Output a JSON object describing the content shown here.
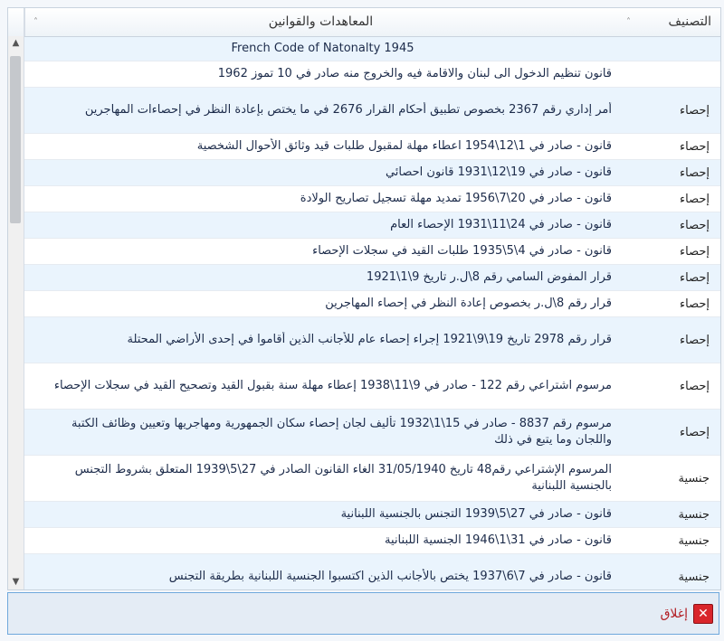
{
  "grid": {
    "columns": {
      "law": "المعاهدات والقوانين",
      "classification": "التصنيف",
      "sort_glyph": "˄"
    },
    "rows": [
      {
        "class": "",
        "text": "French Code of Natonalty 1945",
        "h": 27
      },
      {
        "class": "",
        "text": "قانون تنظيم الدخول الى لبنان والاقامة فيه والخروج منه صادر في 10 تموز 1962",
        "h": 29
      },
      {
        "class": "إحصاء",
        "text": "أمر إداري رقم 2367 بخصوص تطبيق أحكام القرار 2676 في ما يختص بإعادة النظر في إحصاءات المهاجرين",
        "h": 51
      },
      {
        "class": "إحصاء",
        "text": "قانون - صادر في 1\\12\\1954 اعطاء مهلة لمقبول طلبات قيد وثائق الأحوال الشخصية",
        "h": 29
      },
      {
        "class": "إحصاء",
        "text": "قانون - صادر في 19\\12\\1931 قانون احصائي",
        "h": 29
      },
      {
        "class": "إحصاء",
        "text": "قانون - صادر في 20\\7\\1956 تمديد مهلة تسجيل تصاريح الولادة",
        "h": 29
      },
      {
        "class": "إحصاء",
        "text": "قانون - صادر في 24\\11\\1931 الإحصاء العام",
        "h": 29
      },
      {
        "class": "إحصاء",
        "text": "قانون - صادر في 4\\5\\1935 طلبات القيد في سجلات الإحصاء",
        "h": 29
      },
      {
        "class": "إحصاء",
        "text": "قرار المفوض السامي رقم 8\\ل.ر تاريخ 9\\1\\1921",
        "h": 29
      },
      {
        "class": "إحصاء",
        "text": "قرار رقم 8\\ل.ر بخصوص إعادة النظر في إحصاء المهاجرين",
        "h": 29
      },
      {
        "class": "إحصاء",
        "text": "قرار رقم 2978 تاريخ 19\\9\\1921 إجراء إحصاء عام للأجانب الذين أقاموا في إحدى الأراضي المحتلة",
        "h": 51
      },
      {
        "class": "إحصاء",
        "text": "مرسوم اشتراعي رقم 122 - صادر في 9\\11\\1938 إعطاء مهلة سنة بقبول القيد وتصحيح القيد في سجلات الإحصاء",
        "h": 51
      },
      {
        "class": "إحصاء",
        "text": "مرسوم رقم 8837 - صادر في 15\\1\\1932 تأليف لجان إحصاء سكان الجمهورية ومهاجريها وتعيين وظائف الكتبة واللجان وما يتبع في ذلك",
        "h": 51
      },
      {
        "class": "جنسية",
        "text": "المرسوم الإشتراعي رقم48 تاريخ 31/05/1940 الغاء القانون الصادر في 27\\5\\1939 المتعلق بشروط التجنس بالجنسية اللبنانية",
        "h": 51
      },
      {
        "class": "جنسية",
        "text": "قانون - صادر في 27\\5\\1939 التجنس بالجنسية اللبنانية",
        "h": 29
      },
      {
        "class": "جنسية",
        "text": "قانون - صادر في 31\\1\\1946 الجنسية اللبنانية",
        "h": 29
      },
      {
        "class": "جنسية",
        "text": "قانون - صادر في 7\\6\\1937 يختص بالأجانب الذين اكتسبوا الجنسية اللبنانية بطريقة التجنس",
        "h": 51
      }
    ]
  },
  "footer": {
    "close_label": "إغلاق",
    "close_icon": "close-icon",
    "close_glyph": "✕"
  },
  "colors": {
    "row_alt": "#eaf4fd",
    "close_red": "#d9252a",
    "footer_border": "#6fa8dc"
  }
}
